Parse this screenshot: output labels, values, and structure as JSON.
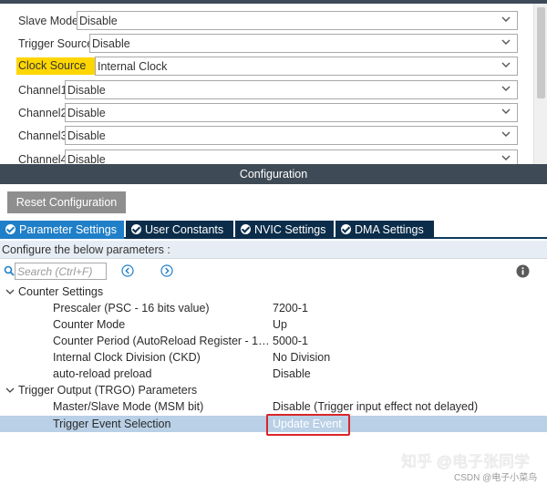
{
  "mode": {
    "rows": [
      {
        "label": "Slave Mode",
        "value": "Disable",
        "highlighted": false
      },
      {
        "label": "Trigger Source",
        "value": "Disable",
        "highlighted": false
      },
      {
        "label": "Clock Source",
        "value": "Internal Clock",
        "highlighted": true
      },
      {
        "label": "Channel1",
        "value": "Disable",
        "highlighted": false
      },
      {
        "label": "Channel2",
        "value": "Disable",
        "highlighted": false
      },
      {
        "label": "Channel3",
        "value": "Disable",
        "highlighted": false
      },
      {
        "label": "Channel4",
        "value": "Disable",
        "highlighted": false
      }
    ]
  },
  "config": {
    "header": "Configuration",
    "reset_label": "Reset Configuration",
    "tabs": [
      {
        "label": "Parameter Settings",
        "active": true
      },
      {
        "label": "User Constants",
        "active": false
      },
      {
        "label": "NVIC Settings",
        "active": false
      },
      {
        "label": "DMA Settings",
        "active": false
      }
    ],
    "configure_text": "Configure the below parameters :",
    "search_placeholder": "Search (Ctrl+F)"
  },
  "groups": {
    "counter": {
      "label": "Counter Settings",
      "params": [
        {
          "name": "Prescaler (PSC - 16 bits value)",
          "value": "7200-1"
        },
        {
          "name": "Counter Mode",
          "value": "Up"
        },
        {
          "name": "Counter Period (AutoReload Register - 16 b...",
          "value": "5000-1"
        },
        {
          "name": "Internal Clock Division (CKD)",
          "value": "No Division"
        },
        {
          "name": "auto-reload preload",
          "value": "Disable"
        }
      ]
    },
    "trgo": {
      "label": "Trigger Output (TRGO) Parameters",
      "params": [
        {
          "name": "Master/Slave Mode (MSM bit)",
          "value": "Disable (Trigger input effect not delayed)"
        },
        {
          "name": "Trigger Event Selection",
          "value": "Update Event",
          "selected": true
        }
      ]
    }
  },
  "watermark": "知乎 @电子张同学",
  "credit": "CSDN @电子小菜鸟",
  "colors": {
    "tab_active": "#1f7fc8",
    "tab_inactive": "#0b2d4a",
    "header_bg": "#3e4a56",
    "highlight_label": "#ffd600",
    "selected_row": "#b9d0e6",
    "annotation_box": "#d9262b"
  }
}
